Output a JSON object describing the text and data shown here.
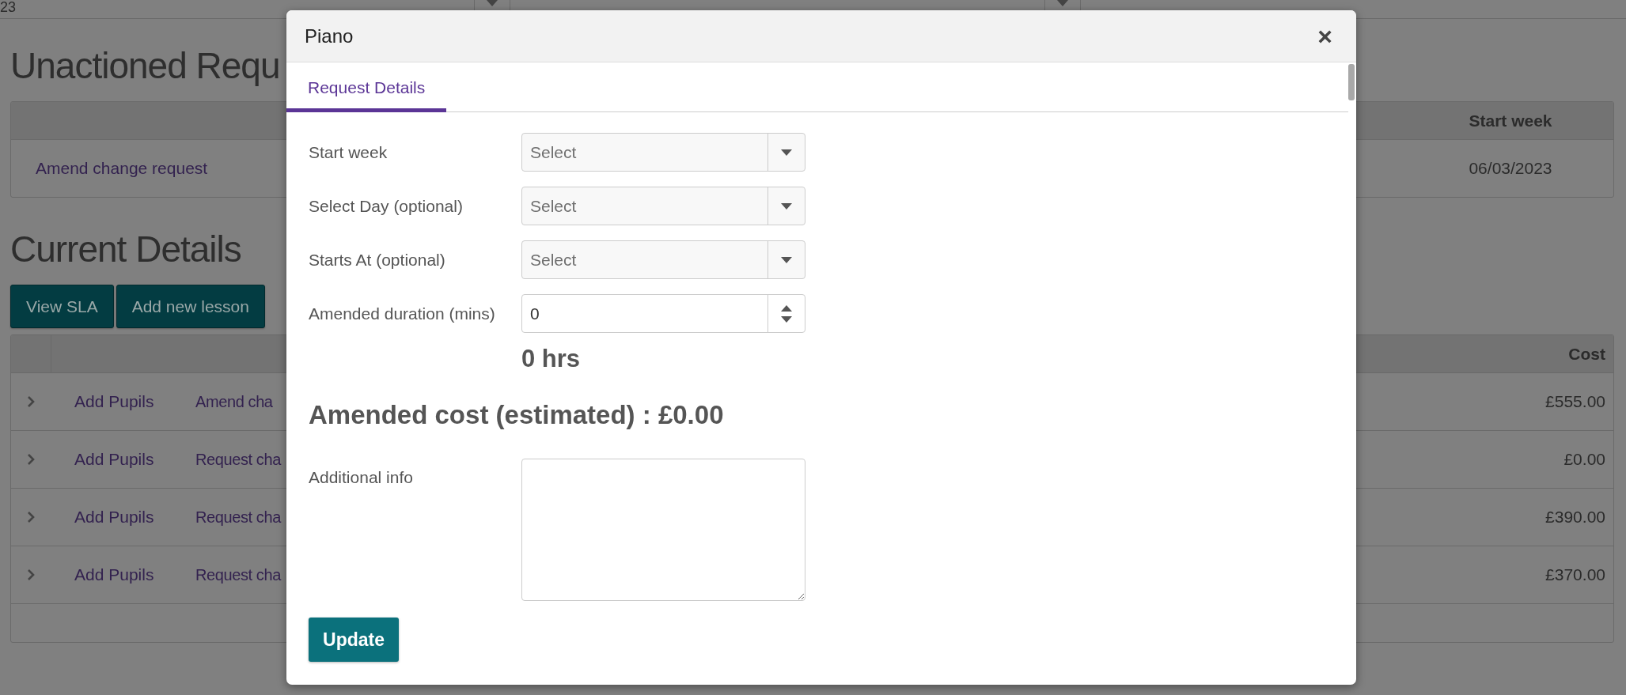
{
  "background": {
    "top_strip": {
      "text": "23"
    },
    "unactioned": {
      "heading": "Unactioned Requ",
      "columns": [
        "Start week"
      ],
      "rows": [
        {
          "request": "Amend change request",
          "start_week": "06/03/2023"
        }
      ]
    },
    "current": {
      "heading": "Current Details",
      "buttons": [
        "View SLA",
        "Add new lesson"
      ],
      "columns": [
        "Cost"
      ],
      "rows": [
        {
          "expanded": false,
          "pupils": "Add Pupils",
          "request": "Amend cha",
          "cost": "£555.00"
        },
        {
          "expanded": false,
          "pupils": "Add Pupils",
          "request": "Request cha",
          "cost": "£0.00"
        },
        {
          "expanded": false,
          "pupils": "Add Pupils",
          "request": "Request cha",
          "cost": "£390.00"
        },
        {
          "expanded": false,
          "pupils": "Add Pupils",
          "request": "Request cha",
          "cost": "£370.00"
        }
      ]
    }
  },
  "dialog": {
    "title": "Piano",
    "close": "×",
    "tabs": [
      {
        "label": "Request Details",
        "selected": true
      }
    ],
    "fields": [
      {
        "kind": "select",
        "label": "Start week",
        "placeholder": "Select"
      },
      {
        "kind": "select",
        "label": "Select Day (optional)",
        "placeholder": "Select"
      },
      {
        "kind": "select",
        "label": "Starts At (optional)",
        "placeholder": "Select"
      },
      {
        "kind": "number",
        "label": "Amended duration (mins)",
        "value": "0"
      }
    ],
    "hours": "0 hrs",
    "cost": "Amended cost (estimated) : £0.00",
    "additional": {
      "label": "Additional info"
    },
    "button": "Update"
  }
}
